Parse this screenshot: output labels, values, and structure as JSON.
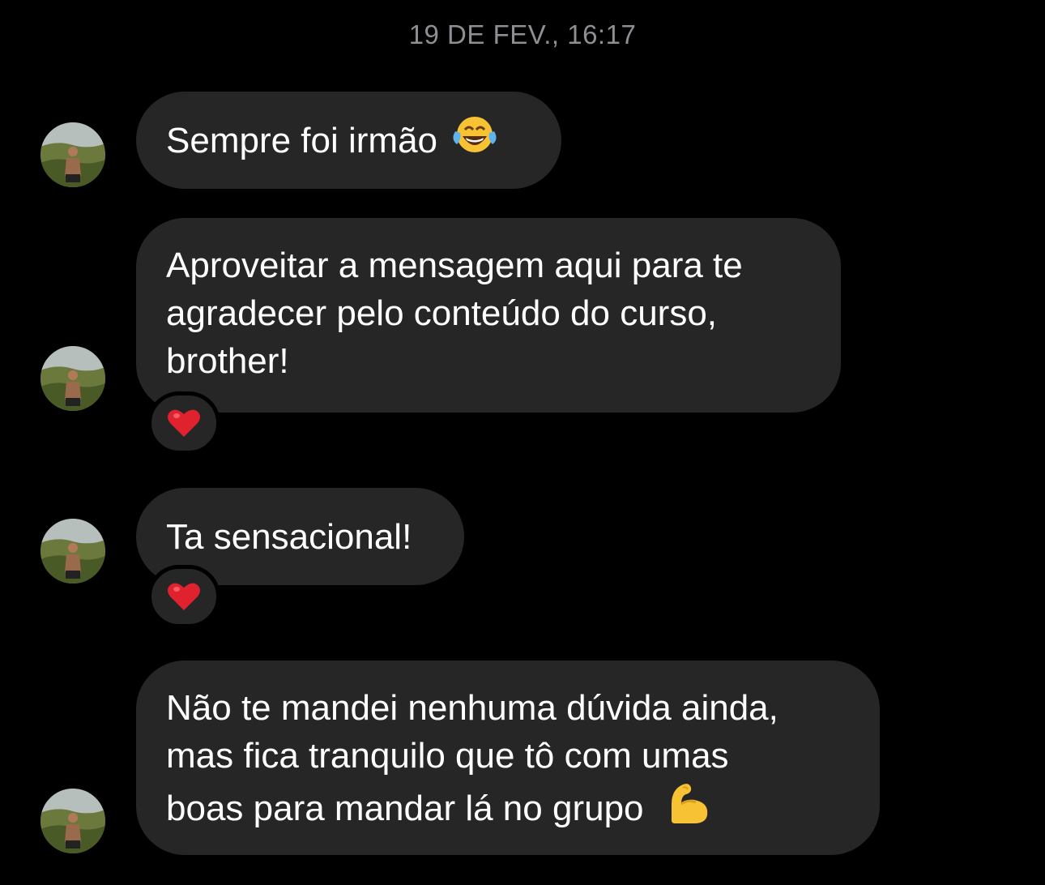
{
  "chat": {
    "timestamp": "19 DE FEV., 16:17",
    "messages": [
      {
        "text": "Sempre foi irmão",
        "emoji": "laughing-tears-emoji",
        "reaction": null
      },
      {
        "text": "Aproveitar a mensagem aqui para te\nagradecer pelo conteúdo do curso,\nbrother!",
        "emoji": null,
        "reaction": "red-heart"
      },
      {
        "text": "Ta sensacional!",
        "emoji": null,
        "reaction": "red-heart"
      },
      {
        "text": "Não te mandei nenhuma dúvida ainda,\nmas fica tranquilo que tô com umas\nboas para mandar lá no grupo",
        "emoji": "flexed-biceps-emoji",
        "reaction": null
      }
    ]
  },
  "colors": {
    "background": "#000000",
    "bubble": "#262626",
    "timestamp": "#8e8e93",
    "heart": "#e0212e"
  }
}
